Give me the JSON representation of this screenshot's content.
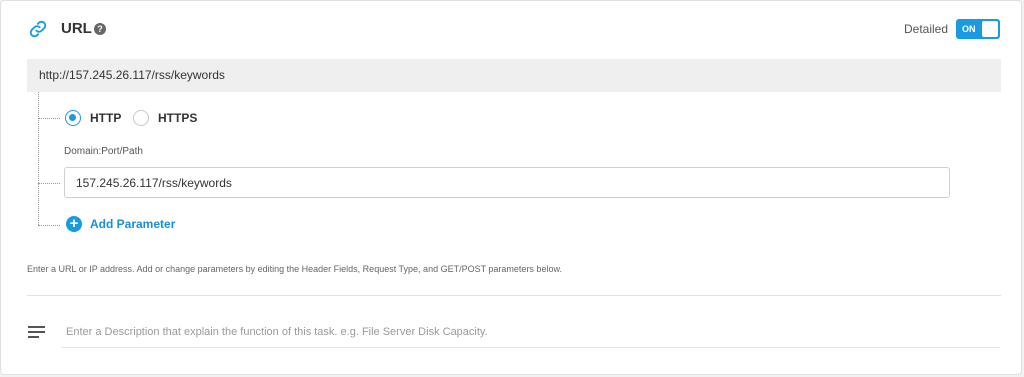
{
  "header": {
    "icon": "link-icon",
    "title": "URL",
    "help_icon": "question-circle-icon",
    "detailed_label": "Detailed",
    "toggle_label": "ON",
    "toggle_state": true,
    "accent_color": "#1a9ae0"
  },
  "url_preview": "http://157.245.26.117/rss/keywords",
  "protocol": {
    "options": [
      {
        "label": "HTTP",
        "selected": true
      },
      {
        "label": "HTTPS",
        "selected": false
      }
    ]
  },
  "domain": {
    "label": "Domain:Port/Path",
    "value": "157.245.26.117/rss/keywords"
  },
  "add_parameter": {
    "icon": "plus-circle-icon",
    "label": "Add Parameter"
  },
  "hint": "Enter a URL or IP address. Add or change parameters by editing the Header Fields, Request Type, and GET/POST parameters below.",
  "description": {
    "icon": "menu-lines-icon",
    "placeholder": "Enter a Description that explain the function of this task. e.g. File Server Disk Capacity."
  }
}
